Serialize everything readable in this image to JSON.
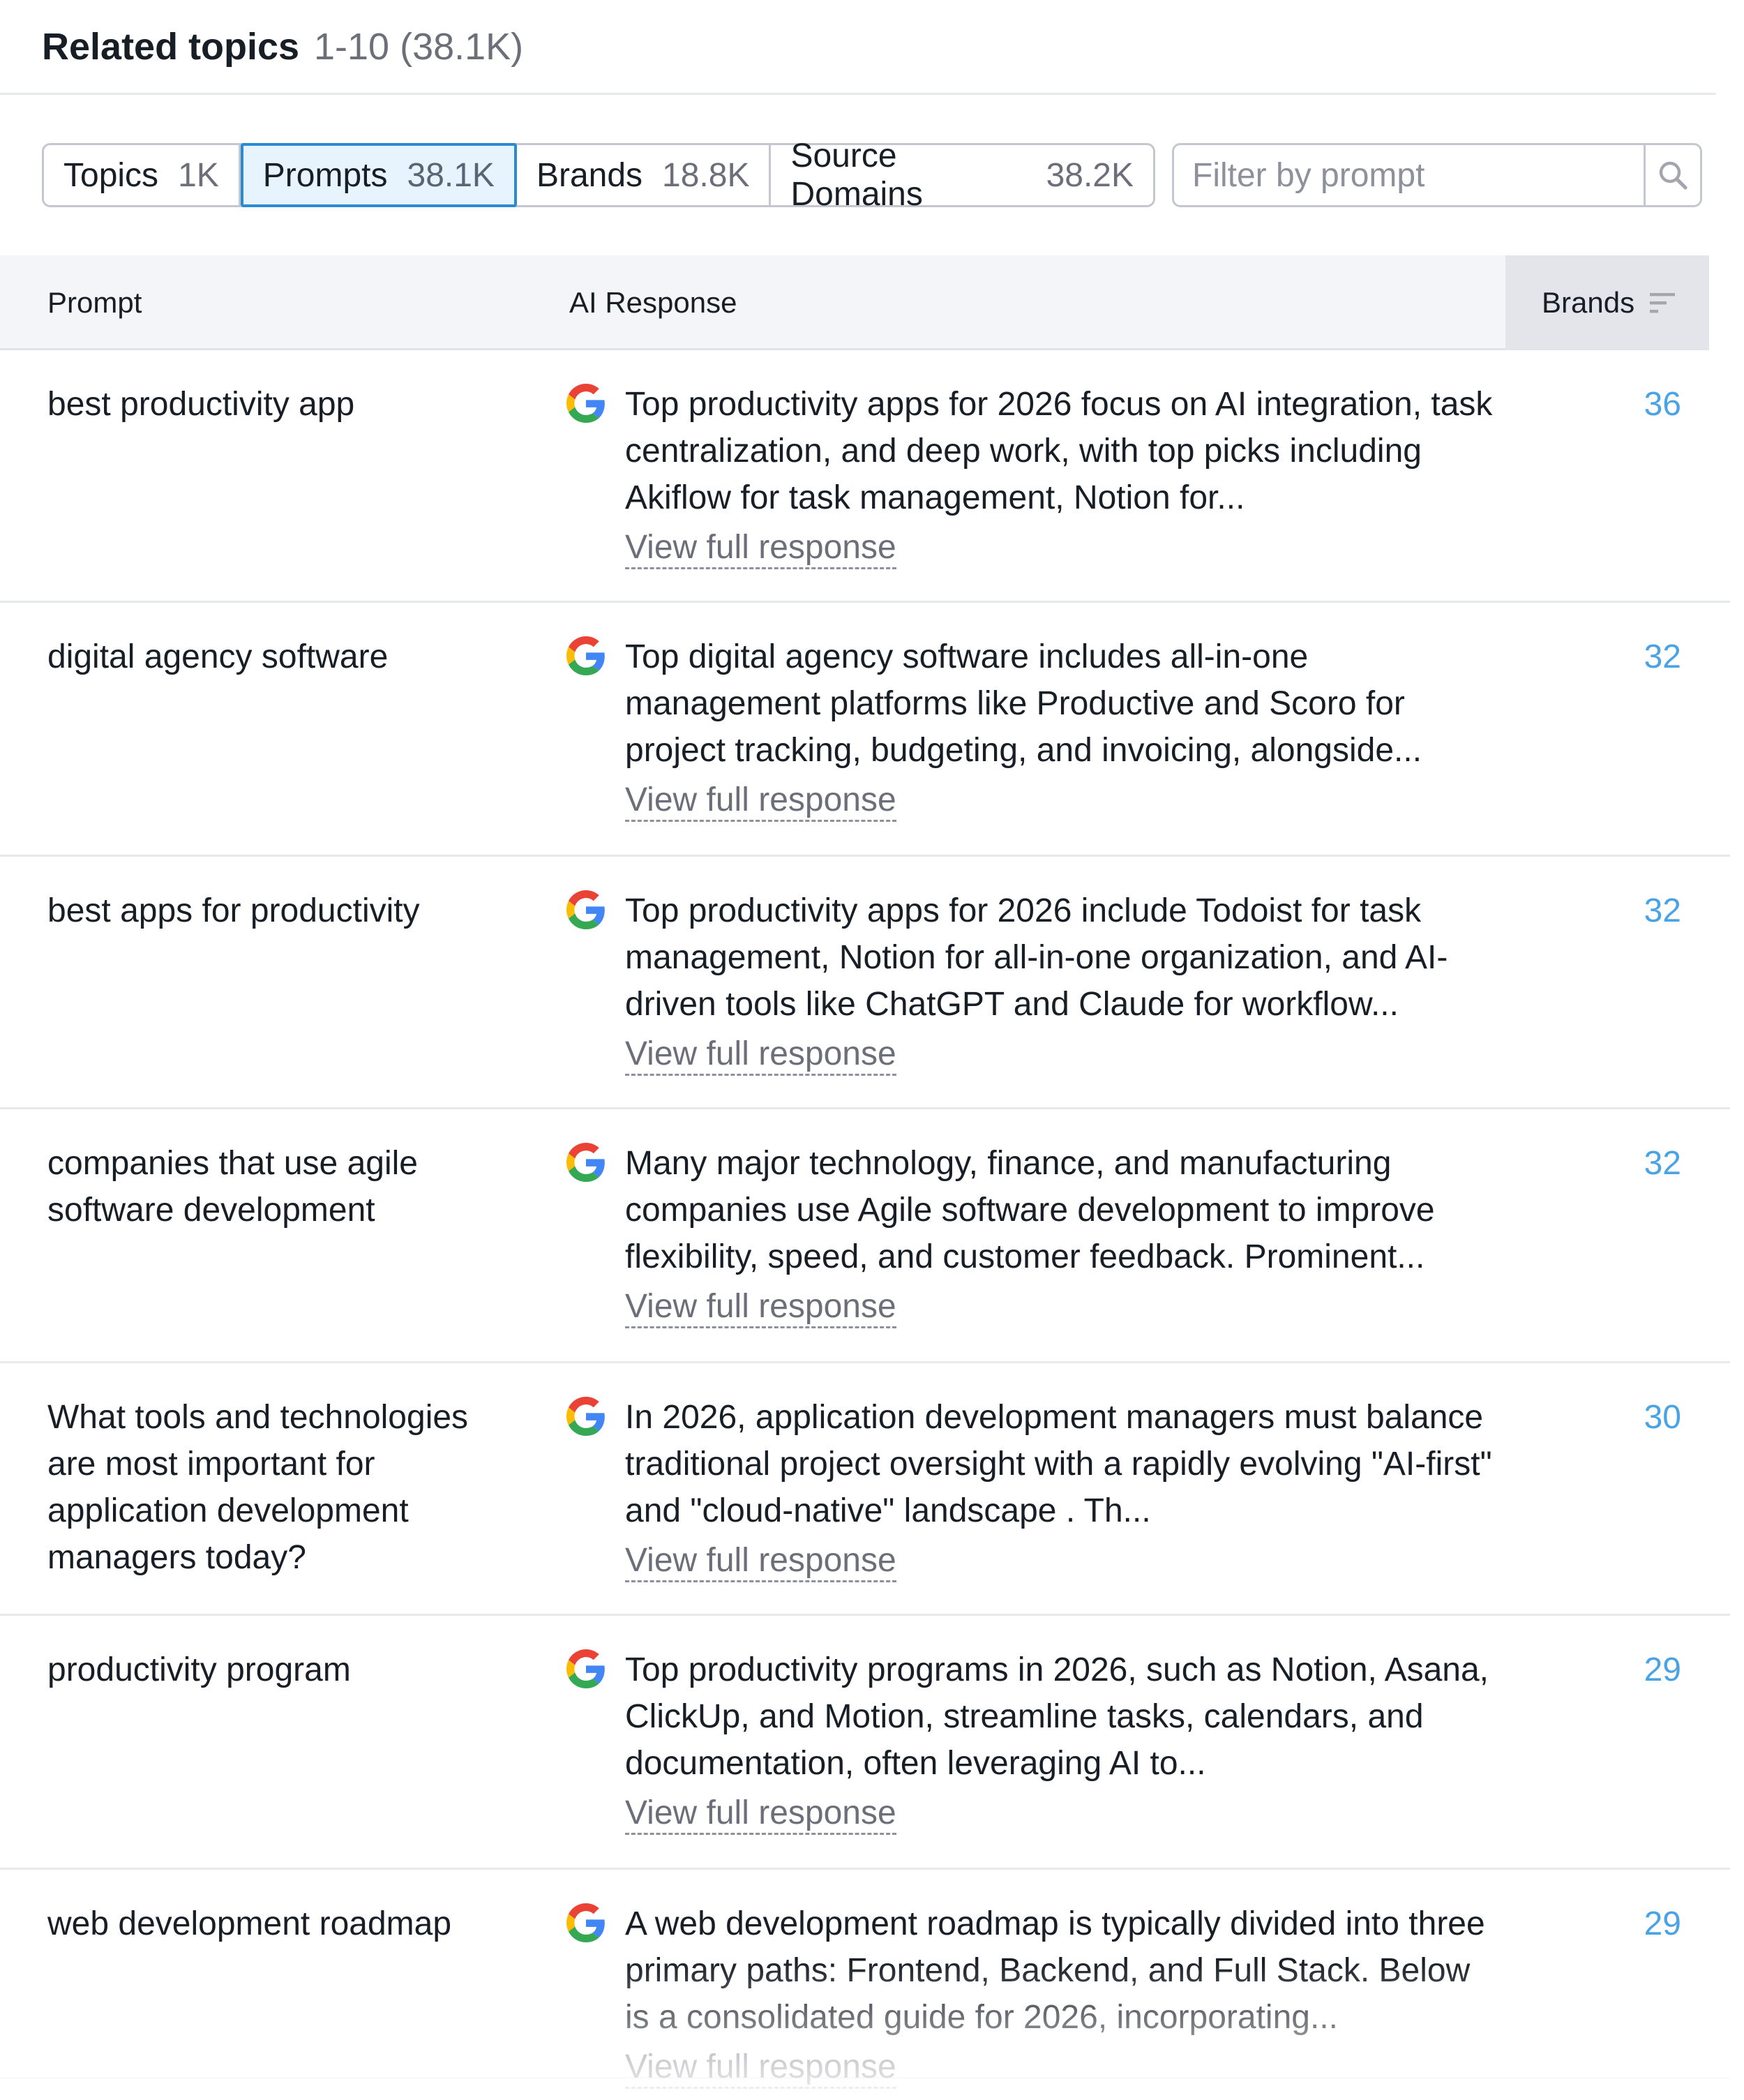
{
  "header": {
    "title": "Related topics",
    "count": "1-10 (38.1K)"
  },
  "tabs": [
    {
      "label": "Topics",
      "count": "1K"
    },
    {
      "label": "Prompts",
      "count": "38.1K"
    },
    {
      "label": "Brands",
      "count": "18.8K"
    },
    {
      "label": "Source Domains",
      "count": "38.2K"
    }
  ],
  "filter": {
    "placeholder": "Filter by prompt",
    "value": ""
  },
  "table": {
    "columns": {
      "prompt": "Prompt",
      "ai": "AI Response",
      "brands": "Brands"
    },
    "link_label": "View full response",
    "rows": [
      {
        "prompt": "best productivity app",
        "response": "Top productivity apps for 2026 focus on AI integration, task centralization, and deep work, with top picks including Akiflow for task management, Notion for...",
        "brands": "36"
      },
      {
        "prompt": "digital agency software",
        "response": "Top digital agency software includes all-in-one management platforms like Productive and Scoro for project tracking, budgeting, and invoicing, alongside...",
        "brands": "32"
      },
      {
        "prompt": "best apps for productivity",
        "response": "Top productivity apps for 2026 include Todoist for task management, Notion for all-in-one organization, and AI-driven tools like ChatGPT and Claude for workflow...",
        "brands": "32"
      },
      {
        "prompt": "companies that use agile software development",
        "response": "Many major technology, finance, and manufacturing companies use Agile software development to improve flexibility, speed, and customer feedback. Prominent...",
        "brands": "32"
      },
      {
        "prompt": "What tools and technologies are most important for application development managers today?",
        "response": "In 2026, application development managers must balance traditional project oversight with a rapidly evolving \"AI-first\" and \"cloud-native\" landscape . Th...",
        "brands": "30"
      },
      {
        "prompt": "productivity program",
        "response": "Top productivity programs in 2026, such as Notion, Asana, ClickUp, and Motion, streamline tasks, calendars, and documentation, often leveraging AI to...",
        "brands": "29"
      },
      {
        "prompt": "web development roadmap",
        "response": "A web development roadmap is typically divided into three primary paths: Frontend, Backend, and Full Stack. Below is a consolidated guide for 2026, incorporating...",
        "brands": "29"
      }
    ]
  }
}
